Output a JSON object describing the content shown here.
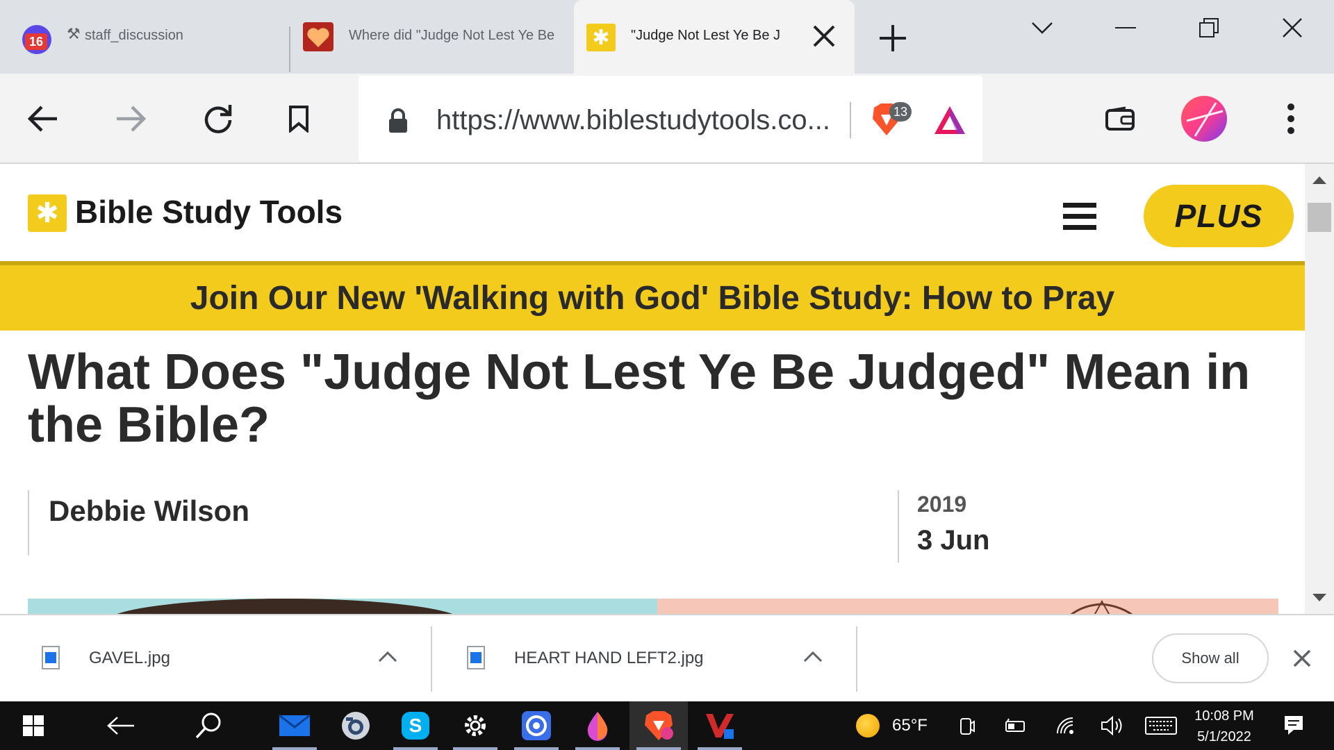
{
  "tabs": [
    {
      "title": "staff_discussion",
      "badge": "16"
    },
    {
      "title": "Where did \"Judge Not Lest Ye Be"
    },
    {
      "title": "\"Judge Not Lest Ye Be J"
    }
  ],
  "toolbar": {
    "url": "https://www.biblestudytools.co...",
    "shields_count": "13"
  },
  "site": {
    "logo_text": "Bible Study Tools",
    "plus_label": "PLUS",
    "banner": "Join Our New 'Walking with God' Bible Study: How to Pray"
  },
  "article": {
    "title": "What Does \"Judge Not Lest Ye Be Judged\" Mean in the Bible?",
    "author": "Debbie Wilson",
    "year": "2019",
    "day_month": "3 Jun"
  },
  "downloads": {
    "items": [
      "GAVEL.jpg",
      "HEART HAND LEFT2.jpg"
    ],
    "show_all": "Show all"
  },
  "taskbar": {
    "temperature": "65°F",
    "time": "10:08 PM",
    "date": "5/1/2022"
  },
  "colors": {
    "brand_yellow": "#f2cb1d",
    "brave_orange": "#fb542b",
    "tab_strip": "#dee1e6"
  }
}
